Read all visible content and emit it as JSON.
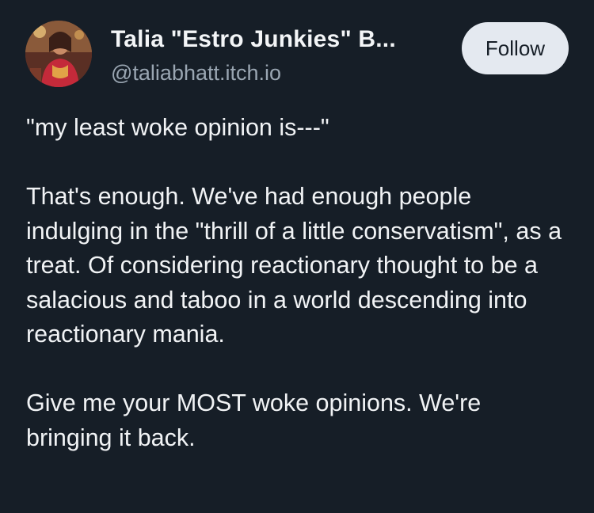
{
  "author": {
    "display_name": "Talia \"Estro Junkies\" B...",
    "handle": "@taliabhatt.itch.io",
    "avatar_icon": "profile-photo"
  },
  "actions": {
    "follow_label": "Follow"
  },
  "post": {
    "paragraphs": [
      "\"my least woke opinion is---\"",
      "That's enough. We've had enough people indulging in the \"thrill of a little conservatism\", as a treat. Of considering reactionary thought to be a salacious and taboo in a world descending into reactionary mania.",
      "Give me your MOST woke opinions. We're bringing it back."
    ]
  },
  "colors": {
    "background": "#161e27",
    "text": "#f1f3f5",
    "muted": "#9aa6b2",
    "button_bg": "#e4e9f0",
    "button_text": "#161e27"
  }
}
